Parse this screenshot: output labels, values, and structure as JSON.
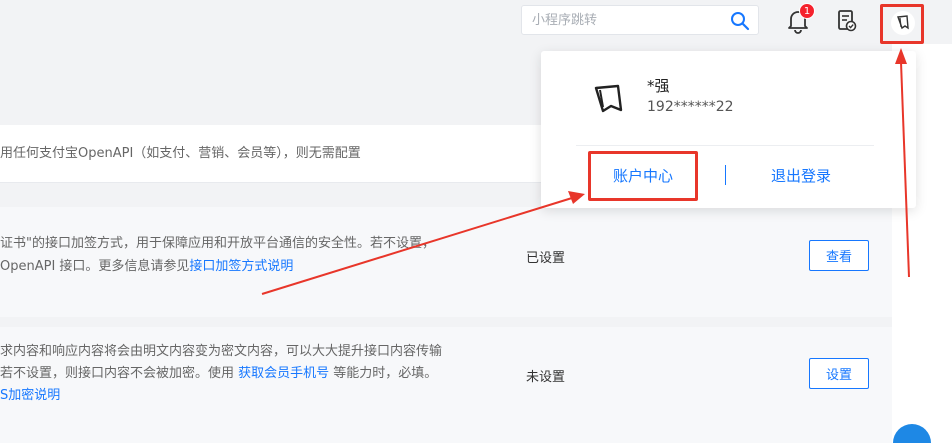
{
  "header": {
    "search": {
      "placeholder": "小程序跳转",
      "value": ""
    },
    "notification_count": "1"
  },
  "rows": [
    {
      "desc_lines": [
        "用任何支付宝OpenAPI（如支付、营销、会员等），则无需配置"
      ]
    },
    {
      "desc_line1": "证书\"的接口加签方式，用于保障应用和开放平台通信的安全性。若不设置，",
      "desc_line2_prefix": "OpenAPI 接口。更多信息请参见",
      "desc_line2_link": "接口加签方式说明",
      "status": "已设置",
      "button": "查看"
    },
    {
      "desc_line1": "求内容和响应内容将会由明文内容变为密文内容，可以大大提升接口内容传输",
      "desc_line2_prefix": "若不设置，则接口内容不会被加密。使用 ",
      "desc_line2_link": "获取会员手机号",
      "desc_line2_suffix": " 等能力时，必填。",
      "desc_line3_link": "S加密说明",
      "status": "未设置",
      "button": "设置"
    }
  ],
  "account_popup": {
    "name": "*强",
    "phone": "192******22",
    "account_center": "账户中心",
    "logout": "退出登录"
  },
  "colors": {
    "accent": "#1677ff",
    "highlight": "#e8362a"
  }
}
